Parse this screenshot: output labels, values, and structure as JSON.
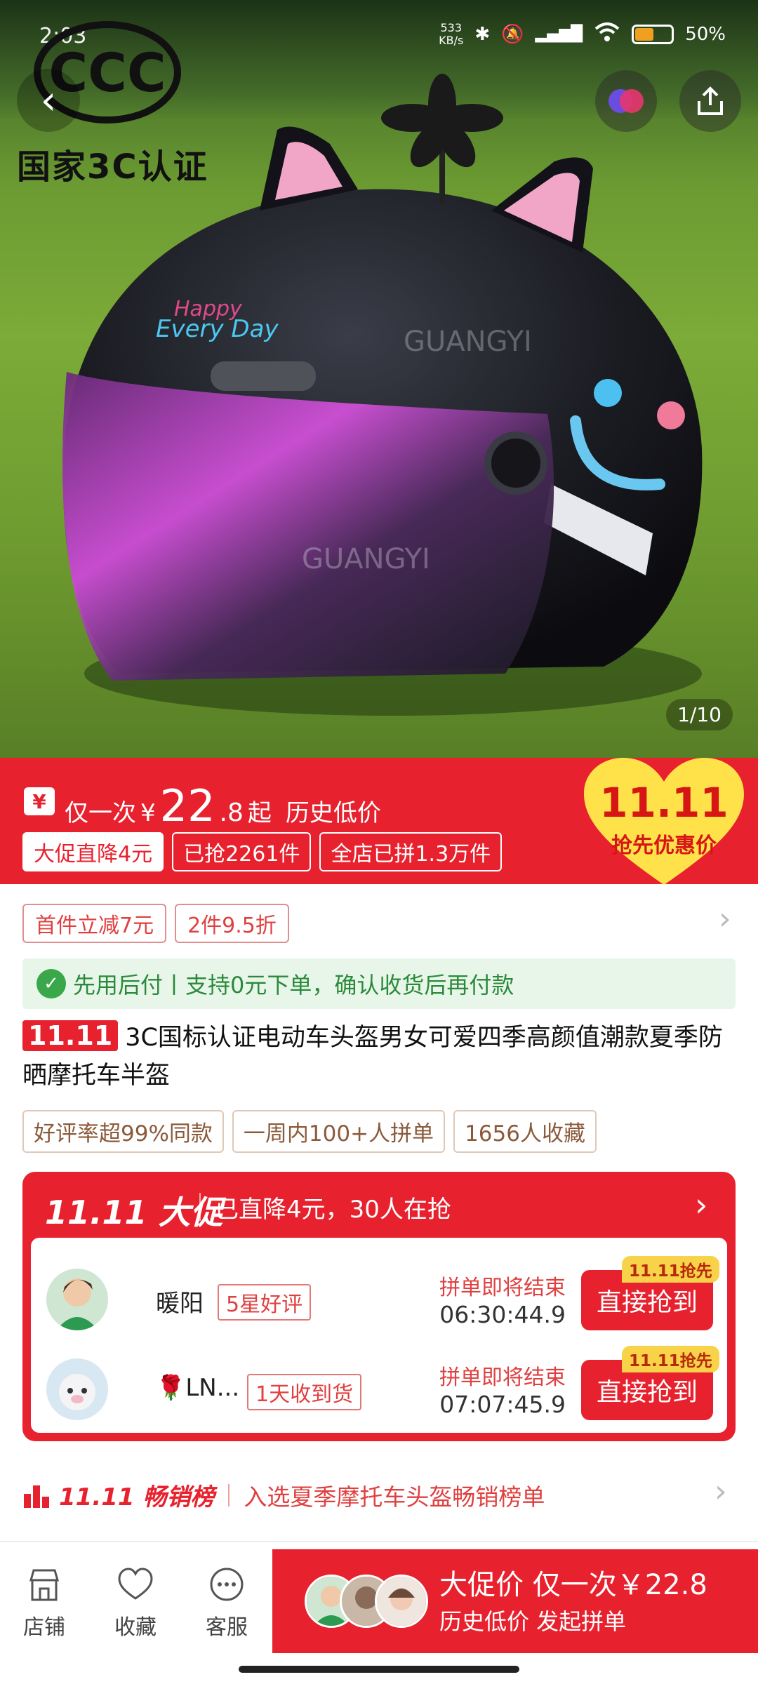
{
  "status_bar": {
    "time": "2:03",
    "net_speed": "533",
    "net_unit": "KB/s",
    "battery": "50%"
  },
  "hero": {
    "cert_label": "国家3C认证",
    "logo_text": "CCC",
    "image_counter": "1/10",
    "helmet_brand": "GUANGYI"
  },
  "promo": {
    "price_prefix": "仅一次",
    "currency": "¥",
    "price_int": "22",
    "price_dec": ".8",
    "price_suffix": "起",
    "price_note": "历史低价",
    "tags": [
      "大促直降4元",
      "已抢2261件",
      "全店已拼1.3万件"
    ],
    "event_title": "11.11",
    "event_sub": "抢先优惠价"
  },
  "coupons": [
    "首件立减7元",
    "2件9.5折"
  ],
  "pay_later": "先用后付丨支持0元下单，确认收货后再付款",
  "product": {
    "badge": "11.11",
    "title": "3C国标认证电动车头盔男女可爱四季高颜值潮款夏季防晒摩托车半盔"
  },
  "stats": [
    "好评率超99%同款",
    "一周内100+人拼单",
    "1656人收藏"
  ],
  "group_buy": {
    "title": "11.11 大促",
    "subtitle": "已直降4元，30人在抢",
    "rows": [
      {
        "name": "暖阳",
        "tag": "5星好评",
        "ending": "拼单即将结束",
        "timer": "06:30:44.9",
        "button": "直接抢到",
        "flag": "11.11抢先"
      },
      {
        "name": "🌹LN...",
        "tag": "1天收到货",
        "ending": "拼单即将结束",
        "timer": "07:07:45.9",
        "button": "直接抢到",
        "flag": "11.11抢先"
      }
    ]
  },
  "ranking": {
    "title": "11.11 畅销榜",
    "text": "入选夏季摩托车头盔畅销榜单"
  },
  "bottom_nav": [
    {
      "label": "店铺",
      "icon": "store-icon"
    },
    {
      "label": "收藏",
      "icon": "heart-icon"
    },
    {
      "label": "客服",
      "icon": "chat-icon"
    }
  ],
  "buy_bar": {
    "line1": "大促价 仅一次￥22.8",
    "line2": "历史低价 发起拼单"
  },
  "colors": {
    "brand_red": "#e8212e",
    "pay_green": "#3aa84a",
    "flag_yellow": "#f8d34a"
  }
}
